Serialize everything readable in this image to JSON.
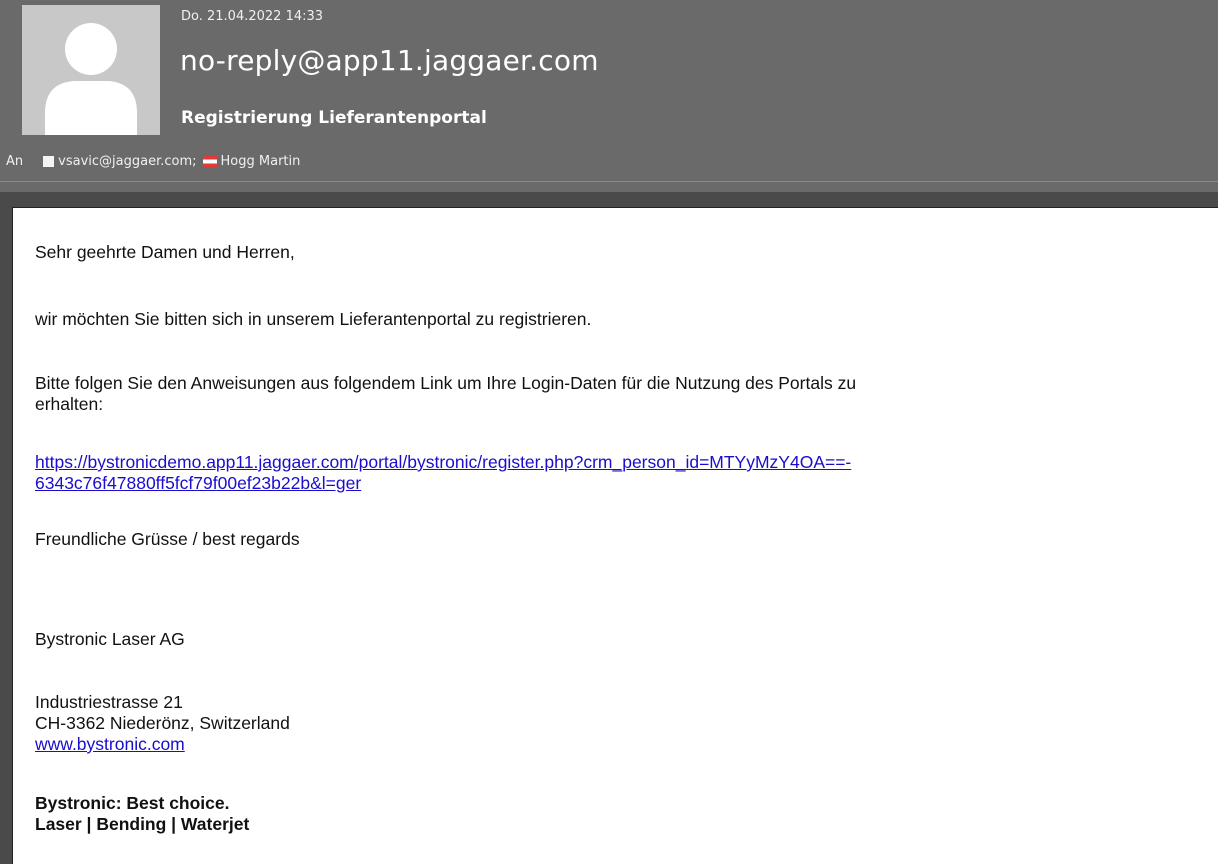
{
  "header": {
    "date": "Do. 21.04.2022 14:33",
    "sender": "no-reply@app11.jaggaer.com",
    "subject": "Registrierung Lieferantenportal",
    "to_label": "An",
    "recipients": [
      {
        "name": "vsavic@jaggaer.com;",
        "icon": "square-icon"
      },
      {
        "name": "Hogg Martin",
        "icon": "flag-icon"
      }
    ],
    "avatar_icon": "person-avatar-icon"
  },
  "body": {
    "greeting": "Sehr geehrte Damen und Herren,",
    "paragraph1": "wir möchten Sie bitten sich in unserem Lieferantenportal zu registrieren.",
    "paragraph2_line1": "Bitte folgen Sie den Anweisungen aus folgendem Link um Ihre Login-Daten für die Nutzung des Portals zu",
    "paragraph2_line2": "erhalten:",
    "link_line1": "https://bystronicdemo.app11.jaggaer.com/portal/bystronic/register.php?crm_person_id=MTYyMzY4OA==-",
    "link_line2": "6343c76f47880ff5fcf79f00ef23b22b&l=ger",
    "closing": "Freundliche Grüsse / best regards",
    "company": "Bystronic Laser AG",
    "address_street": "Industriestrasse 21",
    "address_city": "CH-3362 Niederönz, Switzerland",
    "website": "www.bystronic.com",
    "tagline1": "Bystronic: Best choice.",
    "tagline2": "Laser | Bending | Waterjet"
  },
  "colors": {
    "header_bg": "#6a6a6a",
    "link": "#1a0dcc",
    "flag_red": "#e03a3a"
  }
}
